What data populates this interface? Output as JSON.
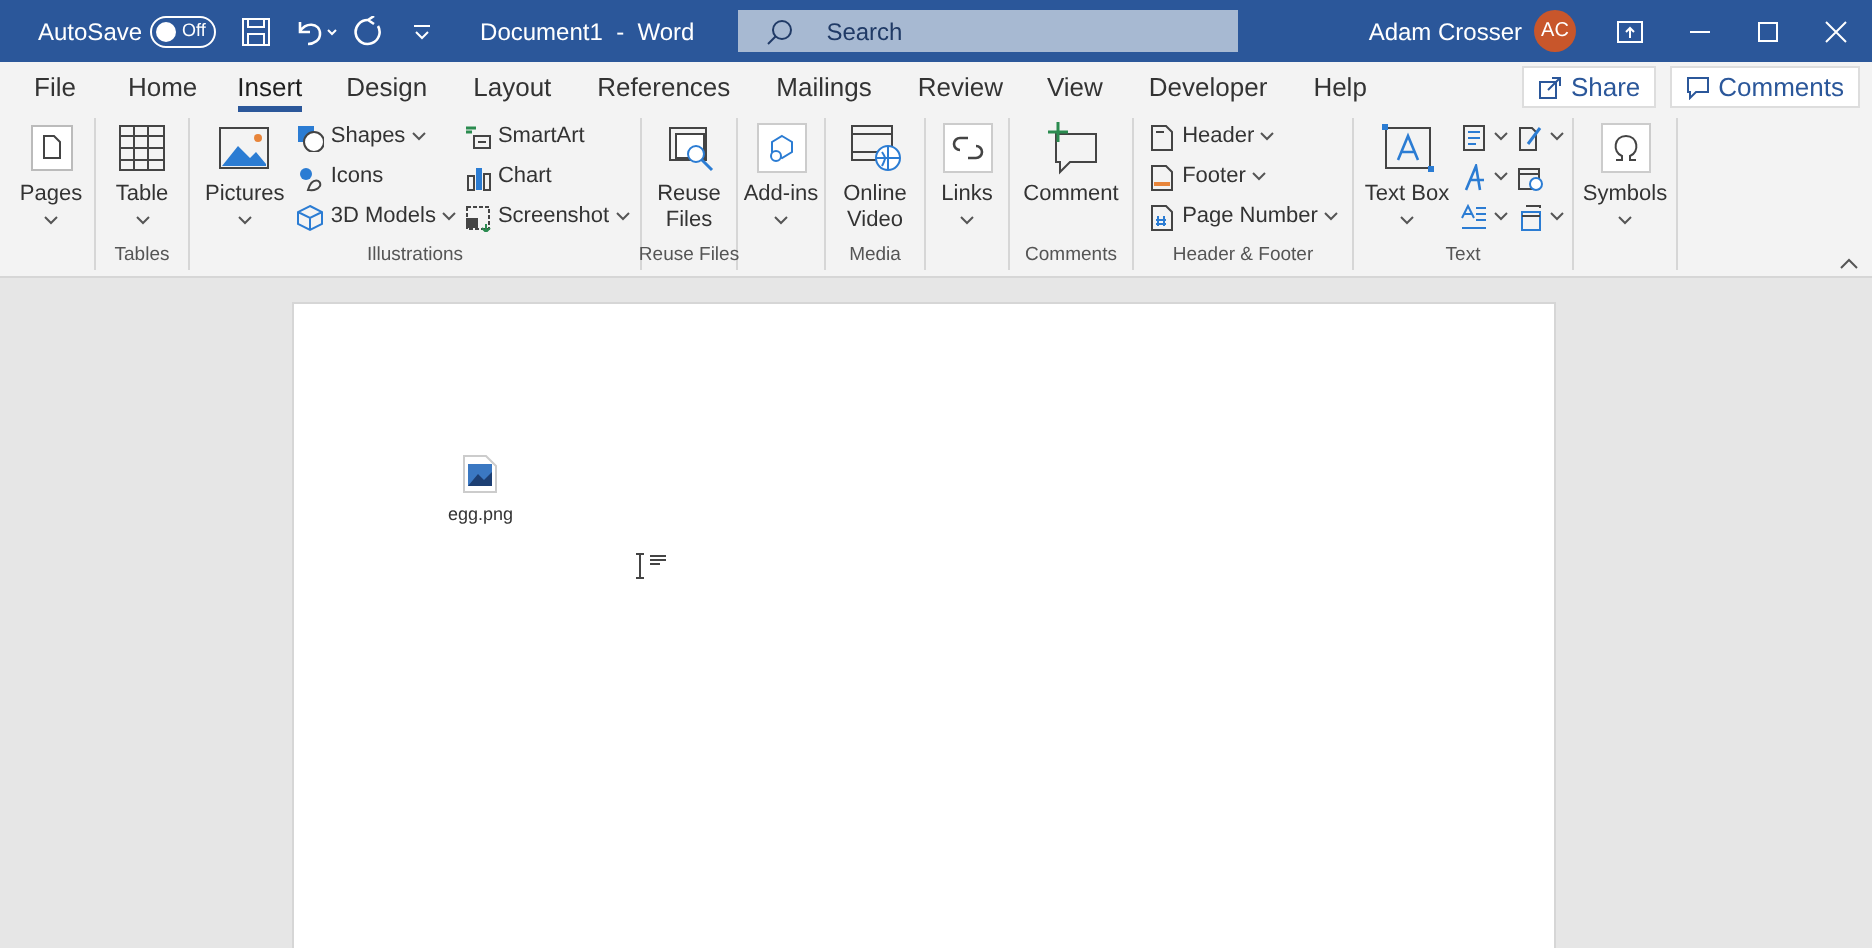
{
  "title_bar": {
    "autosave_label": "AutoSave",
    "autosave_toggle": {
      "label": "Off",
      "on": false
    },
    "document_title": "Document1  -  Word",
    "search": {
      "placeholder": "Search"
    },
    "user_name": "Adam Crosser",
    "avatar_initials": "AC"
  },
  "tabs": [
    {
      "label": "File",
      "selected": false
    },
    {
      "label": "Home",
      "selected": false
    },
    {
      "label": "Insert",
      "selected": true
    },
    {
      "label": "Design",
      "selected": false
    },
    {
      "label": "Layout",
      "selected": false
    },
    {
      "label": "References",
      "selected": false
    },
    {
      "label": "Mailings",
      "selected": false
    },
    {
      "label": "Review",
      "selected": false
    },
    {
      "label": "View",
      "selected": false
    },
    {
      "label": "Developer",
      "selected": false
    },
    {
      "label": "Help",
      "selected": false
    }
  ],
  "share_button": "Share",
  "comments_button": "Comments",
  "ribbon_groups": [
    {
      "items": [
        {
          "kind": "large",
          "label": "Pages",
          "dropdown": true
        }
      ]
    },
    {
      "label": "Tables",
      "items": [
        {
          "kind": "large",
          "label": "Table",
          "dropdown": true
        }
      ]
    },
    {
      "label": "Illustrations",
      "items": [
        {
          "kind": "large",
          "label": "Pictures",
          "dropdown": true
        },
        {
          "kind": "stack",
          "items": [
            {
              "label": "Shapes",
              "dropdown": true
            },
            {
              "label": "Icons",
              "dropdown": false
            },
            {
              "label": "3D Models",
              "dropdown": true
            }
          ]
        },
        {
          "kind": "stack",
          "items": [
            {
              "label": "SmartArt",
              "dropdown": false
            },
            {
              "label": "Chart",
              "dropdown": false
            },
            {
              "label": "Screenshot",
              "dropdown": true
            }
          ]
        }
      ]
    },
    {
      "label": "Reuse Files",
      "items": [
        {
          "kind": "large",
          "label": "Reuse Files",
          "dropdown": false
        }
      ]
    },
    {
      "items": [
        {
          "kind": "large",
          "label": "Add-ins",
          "dropdown": true
        }
      ]
    },
    {
      "label": "Media",
      "items": [
        {
          "kind": "large",
          "label": "Online Video",
          "dropdown": false
        }
      ]
    },
    {
      "items": [
        {
          "kind": "large",
          "label": "Links",
          "dropdown": true
        }
      ]
    },
    {
      "label": "Comments",
      "items": [
        {
          "kind": "large",
          "label": "Comment",
          "dropdown": false
        }
      ]
    },
    {
      "label": "Header & Footer",
      "items": [
        {
          "kind": "stack",
          "items": [
            {
              "label": "Header",
              "dropdown": true
            },
            {
              "label": "Footer",
              "dropdown": true
            },
            {
              "label": "Page Number",
              "dropdown": true
            }
          ]
        }
      ]
    },
    {
      "label": "Text",
      "items": [
        {
          "kind": "large",
          "label": "Text Box",
          "dropdown": true
        },
        {
          "kind": "stack",
          "items": [
            {
              "dropdown": true
            },
            {
              "dropdown": true
            },
            {
              "dropdown": true
            }
          ]
        },
        {
          "kind": "stack",
          "items": [
            {
              "dropdown": true
            },
            {
              "dropdown": false
            },
            {
              "dropdown": true
            }
          ]
        }
      ]
    },
    {
      "items": [
        {
          "kind": "large",
          "label": "Symbols",
          "dropdown": true
        }
      ]
    }
  ],
  "document": {
    "attachment": {
      "file_name": "egg.png"
    }
  }
}
